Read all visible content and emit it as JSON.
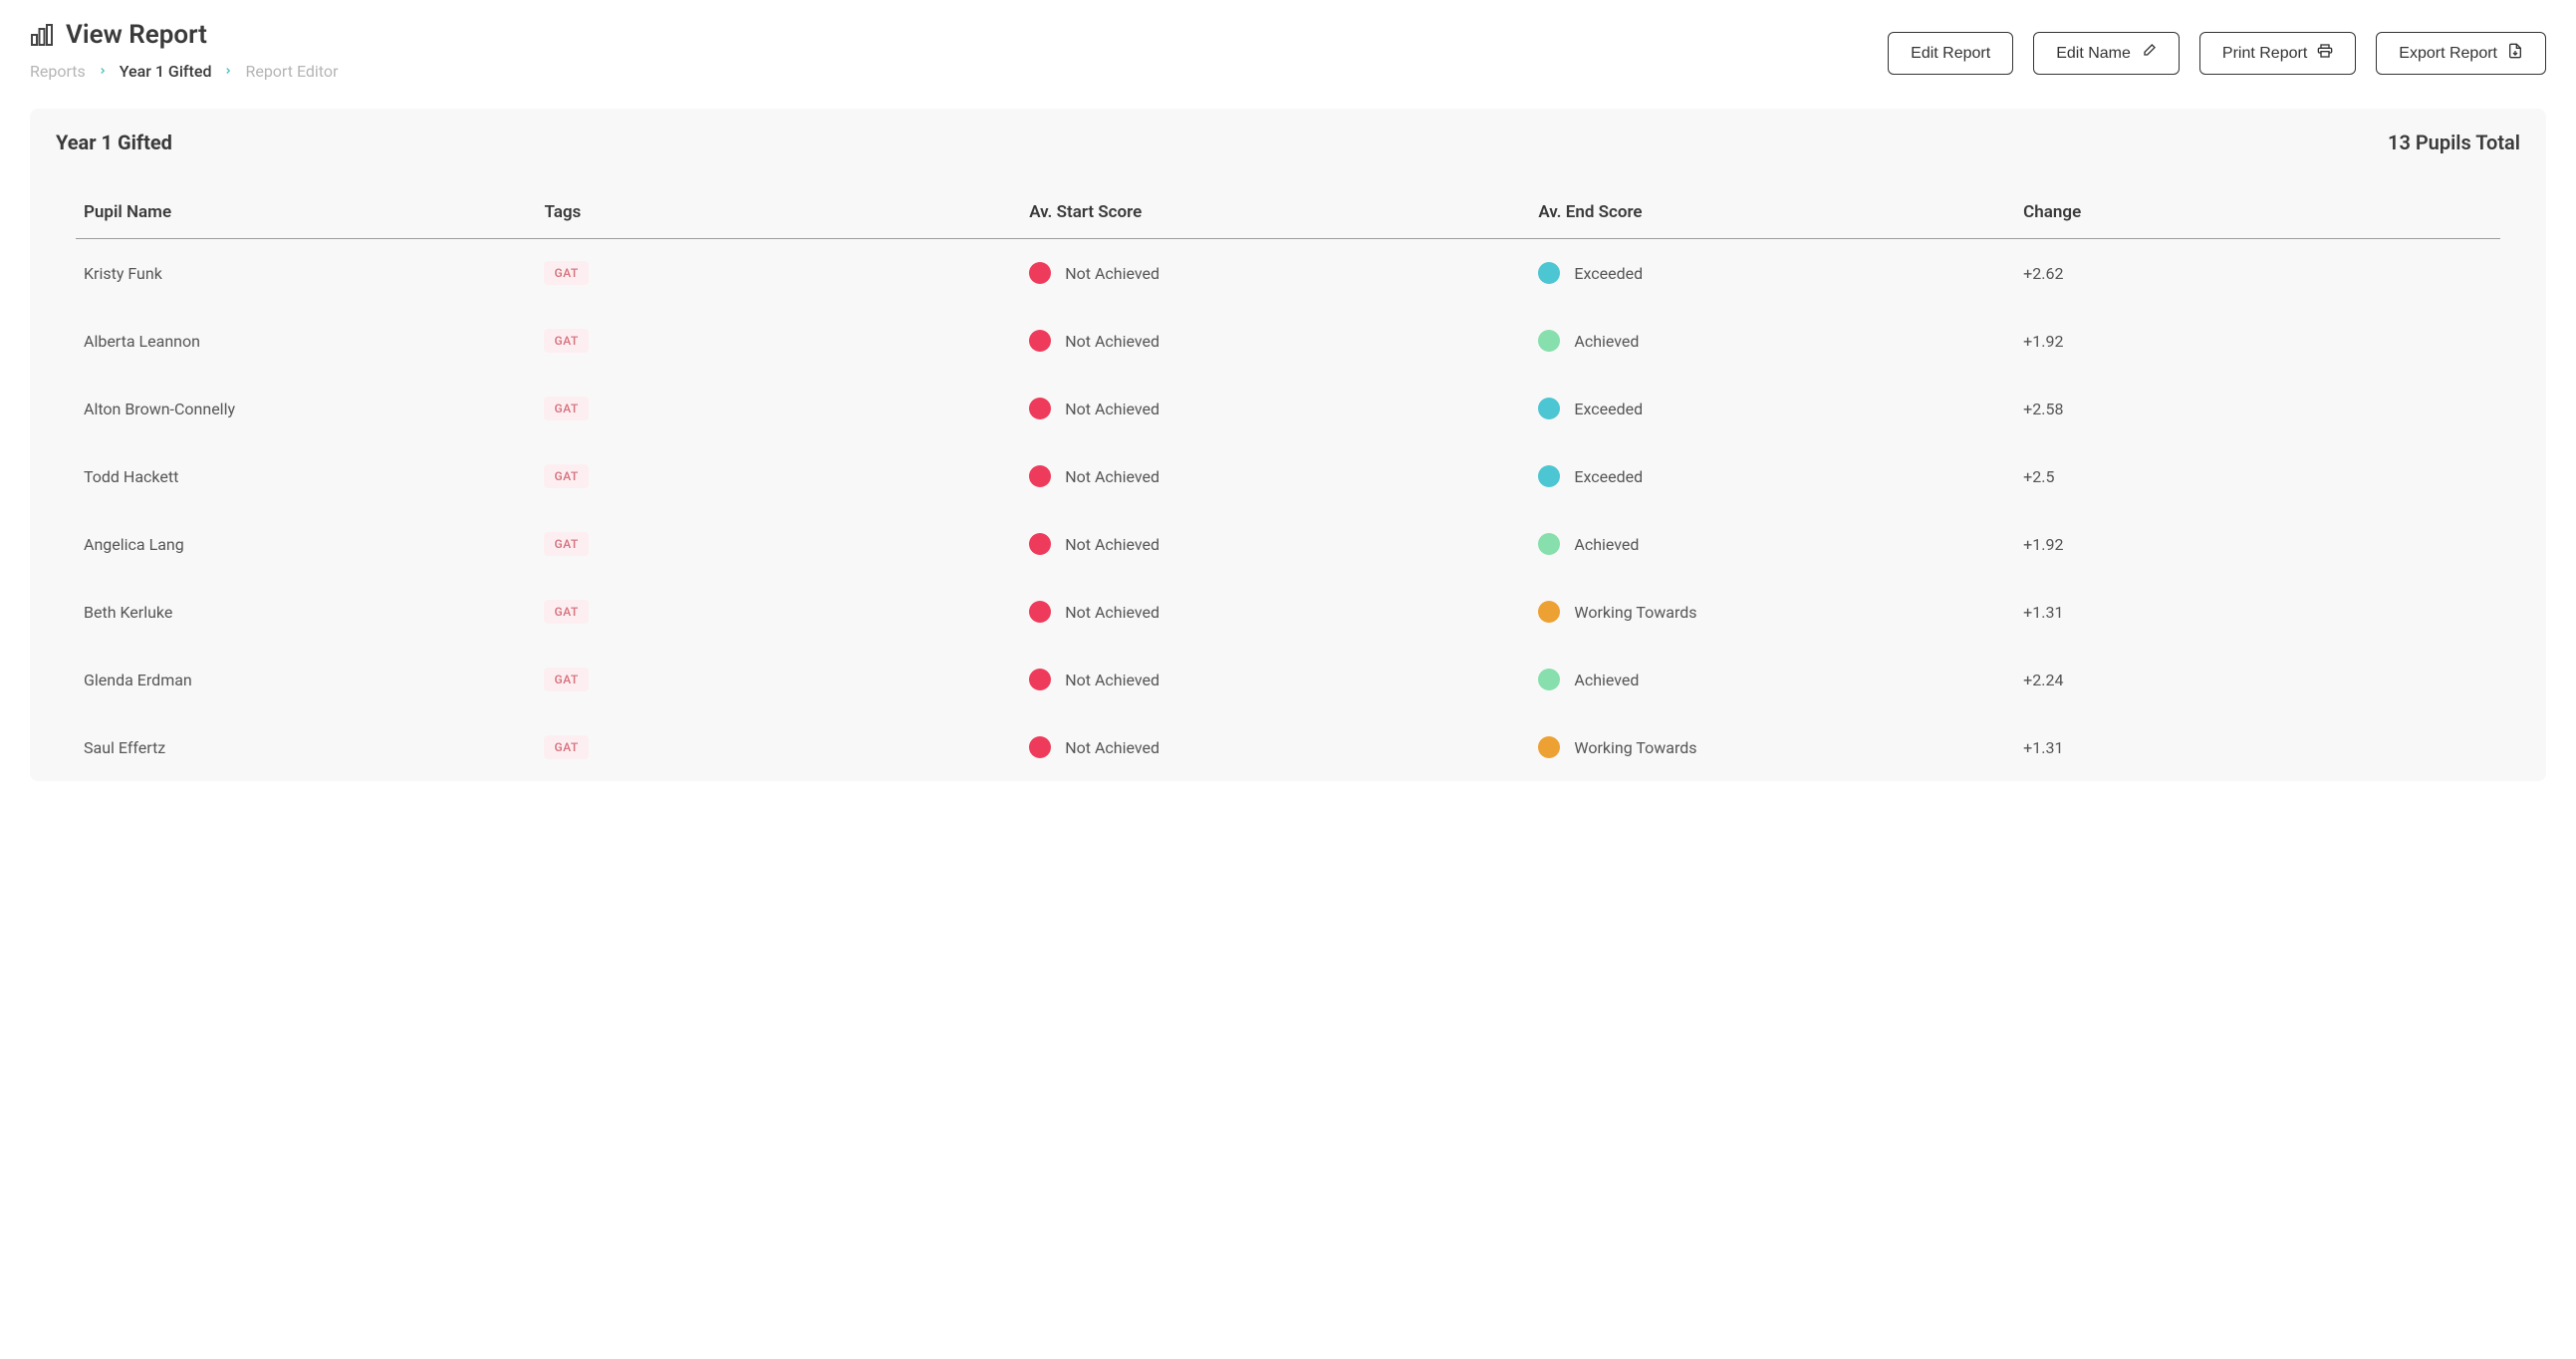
{
  "header": {
    "title": "View Report",
    "breadcrumb": {
      "root": "Reports",
      "group": "Year 1 Gifted",
      "leaf": "Report Editor"
    },
    "actions": {
      "edit_report": "Edit Report",
      "edit_name": "Edit Name",
      "print_report": "Print Report",
      "export_report": "Export Report"
    }
  },
  "panel": {
    "title": "Year 1 Gifted",
    "count_label": "13 Pupils Total"
  },
  "columns": {
    "name": "Pupil Name",
    "tags": "Tags",
    "start": "Av. Start Score",
    "end": "Av. End Score",
    "change": "Change"
  },
  "tag_label": "GAT",
  "score_labels": {
    "not_achieved": "Not Achieved",
    "exceeded": "Exceeded",
    "achieved": "Achieved",
    "working_towards": "Working Towards"
  },
  "rows": [
    {
      "name": "Kristy Funk",
      "start": "not_achieved",
      "end": "exceeded",
      "change": "+2.62"
    },
    {
      "name": "Alberta Leannon",
      "start": "not_achieved",
      "end": "achieved",
      "change": "+1.92"
    },
    {
      "name": "Alton Brown-Connelly",
      "start": "not_achieved",
      "end": "exceeded",
      "change": "+2.58"
    },
    {
      "name": "Todd Hackett",
      "start": "not_achieved",
      "end": "exceeded",
      "change": "+2.5"
    },
    {
      "name": "Angelica Lang",
      "start": "not_achieved",
      "end": "achieved",
      "change": "+1.92"
    },
    {
      "name": "Beth Kerluke",
      "start": "not_achieved",
      "end": "working_towards",
      "change": "+1.31"
    },
    {
      "name": "Glenda Erdman",
      "start": "not_achieved",
      "end": "achieved",
      "change": "+2.24"
    },
    {
      "name": "Saul Effertz",
      "start": "not_achieved",
      "end": "working_towards",
      "change": "+1.31"
    }
  ],
  "colors": {
    "not_achieved": "#ee3b5b",
    "exceeded": "#4cc6d2",
    "achieved": "#86dfac",
    "working_towards": "#eda132",
    "tag_bg": "#fdeff1",
    "tag_fg": "#d87a86"
  }
}
